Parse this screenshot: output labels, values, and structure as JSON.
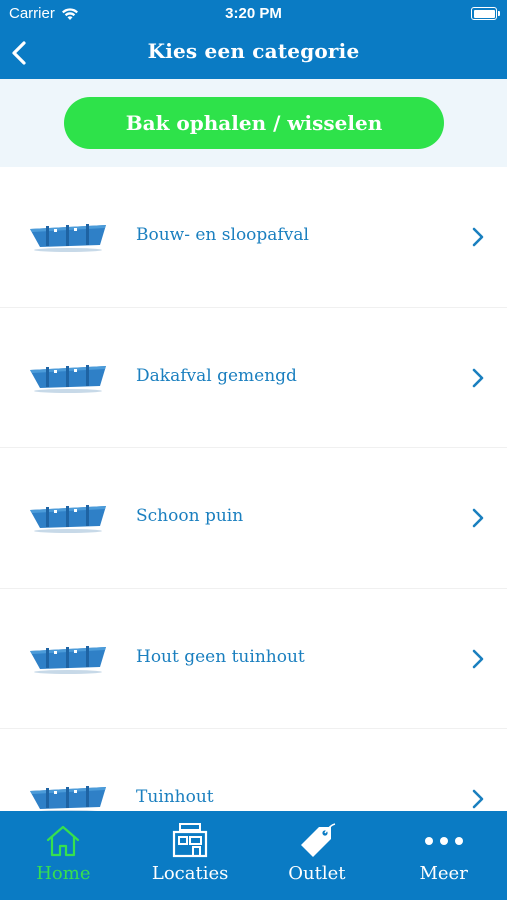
{
  "status_bar": {
    "carrier": "Carrier",
    "time": "3:20 PM",
    "wifi_icon": "wifi-icon",
    "battery_icon": "battery-icon"
  },
  "nav": {
    "title": "Kies een categorie",
    "back_icon": "chevron-left-icon"
  },
  "action": {
    "label": "Bak ophalen / wisselen",
    "color": "#2ee24a"
  },
  "categories": [
    {
      "label": "Bouw- en sloopafval",
      "icon": "container-icon"
    },
    {
      "label": "Dakafval gemengd",
      "icon": "container-icon"
    },
    {
      "label": "Schoon puin",
      "icon": "container-icon"
    },
    {
      "label": "Hout geen tuinhout",
      "icon": "container-icon"
    },
    {
      "label": "Tuinhout",
      "icon": "container-icon"
    }
  ],
  "tabs": [
    {
      "label": "Home",
      "icon": "home-icon",
      "active": true
    },
    {
      "label": "Locaties",
      "icon": "locations-icon",
      "active": false
    },
    {
      "label": "Outlet",
      "icon": "tag-icon",
      "active": false
    },
    {
      "label": "Meer",
      "icon": "more-icon",
      "active": false
    }
  ],
  "colors": {
    "brand_blue": "#0a7bc4",
    "active_tab": "#36e04e",
    "list_text": "#1a7fbf",
    "band_background": "#eef6fb"
  }
}
